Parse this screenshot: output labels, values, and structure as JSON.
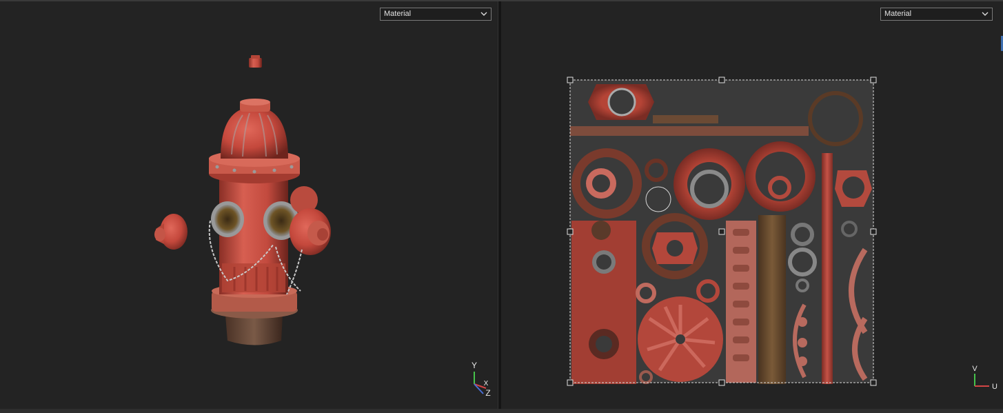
{
  "left_viewport": {
    "mode_select": {
      "value": "Material"
    },
    "axes": {
      "y": "Y",
      "x": "X",
      "z": "Z"
    }
  },
  "right_viewport": {
    "mode_select": {
      "value": "Material"
    },
    "axes": {
      "v": "V",
      "u": "U"
    }
  },
  "colors": {
    "viewport_bg": "#232323",
    "hydrant_red": "#c44a3e",
    "hydrant_dark": "#7a2a22",
    "uv_bg": "#3a3a3a",
    "selection": "#dddddd",
    "axis_y": "#46c34b",
    "axis_x": "#d34545",
    "axis_z": "#4a6fd6"
  }
}
